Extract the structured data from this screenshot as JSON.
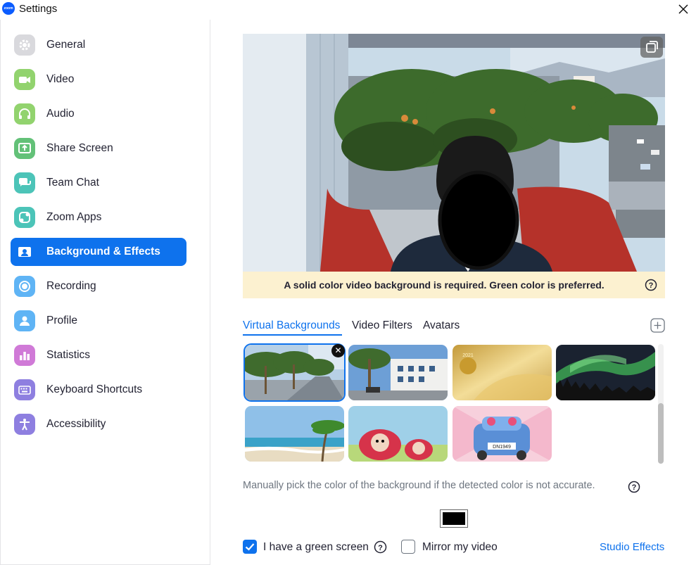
{
  "window": {
    "title": "Settings",
    "logo_text": "zoom"
  },
  "sidebar": {
    "items": [
      {
        "label": "General",
        "icon": "gear-icon",
        "color": "#d9d9dd"
      },
      {
        "label": "Video",
        "icon": "video-camera-icon",
        "color": "#92d36e"
      },
      {
        "label": "Audio",
        "icon": "headphones-icon",
        "color": "#92d36e"
      },
      {
        "label": "Share Screen",
        "icon": "share-screen-icon",
        "color": "#63c178"
      },
      {
        "label": "Team Chat",
        "icon": "chat-bubbles-icon",
        "color": "#4cc4b8"
      },
      {
        "label": "Zoom Apps",
        "icon": "apps-icon",
        "color": "#4cc4b8"
      },
      {
        "label": "Background & Effects",
        "icon": "person-portrait-icon",
        "color": "#0e72ed",
        "active": true
      },
      {
        "label": "Recording",
        "icon": "record-icon",
        "color": "#5fb4f5"
      },
      {
        "label": "Profile",
        "icon": "person-icon",
        "color": "#5fb4f5"
      },
      {
        "label": "Statistics",
        "icon": "bar-chart-icon",
        "color": "#d07ad7"
      },
      {
        "label": "Keyboard Shortcuts",
        "icon": "keyboard-icon",
        "color": "#8e7fe0"
      },
      {
        "label": "Accessibility",
        "icon": "accessibility-icon",
        "color": "#8e7fe0"
      }
    ]
  },
  "preview": {
    "notice": "A solid color video background is required. Green color is preferred."
  },
  "tabs": [
    {
      "label": "Virtual Backgrounds",
      "active": true
    },
    {
      "label": "Video Filters",
      "active": false
    },
    {
      "label": "Avatars",
      "active": false
    }
  ],
  "backgrounds": [
    {
      "name": "Palm trees street",
      "selected": true
    },
    {
      "name": "Palm trees building",
      "selected": false
    },
    {
      "name": "Gold 2021",
      "selected": false
    },
    {
      "name": "Aurora",
      "selected": false
    },
    {
      "name": "Beach",
      "selected": false
    },
    {
      "name": "Cartoon cars",
      "selected": false
    },
    {
      "name": "Cartoon car DN1949",
      "selected": false
    }
  ],
  "thumb_text": {
    "gold_year": "2021",
    "plate": "DN1949"
  },
  "manual_pick_text": "Manually pick the color of the background if the detected color is not accurate.",
  "picked_color": "#000000",
  "options": {
    "green_screen_label": "I have a green screen",
    "green_screen_checked": true,
    "mirror_label": "Mirror my video",
    "mirror_checked": false
  },
  "studio_effects_label": "Studio Effects"
}
